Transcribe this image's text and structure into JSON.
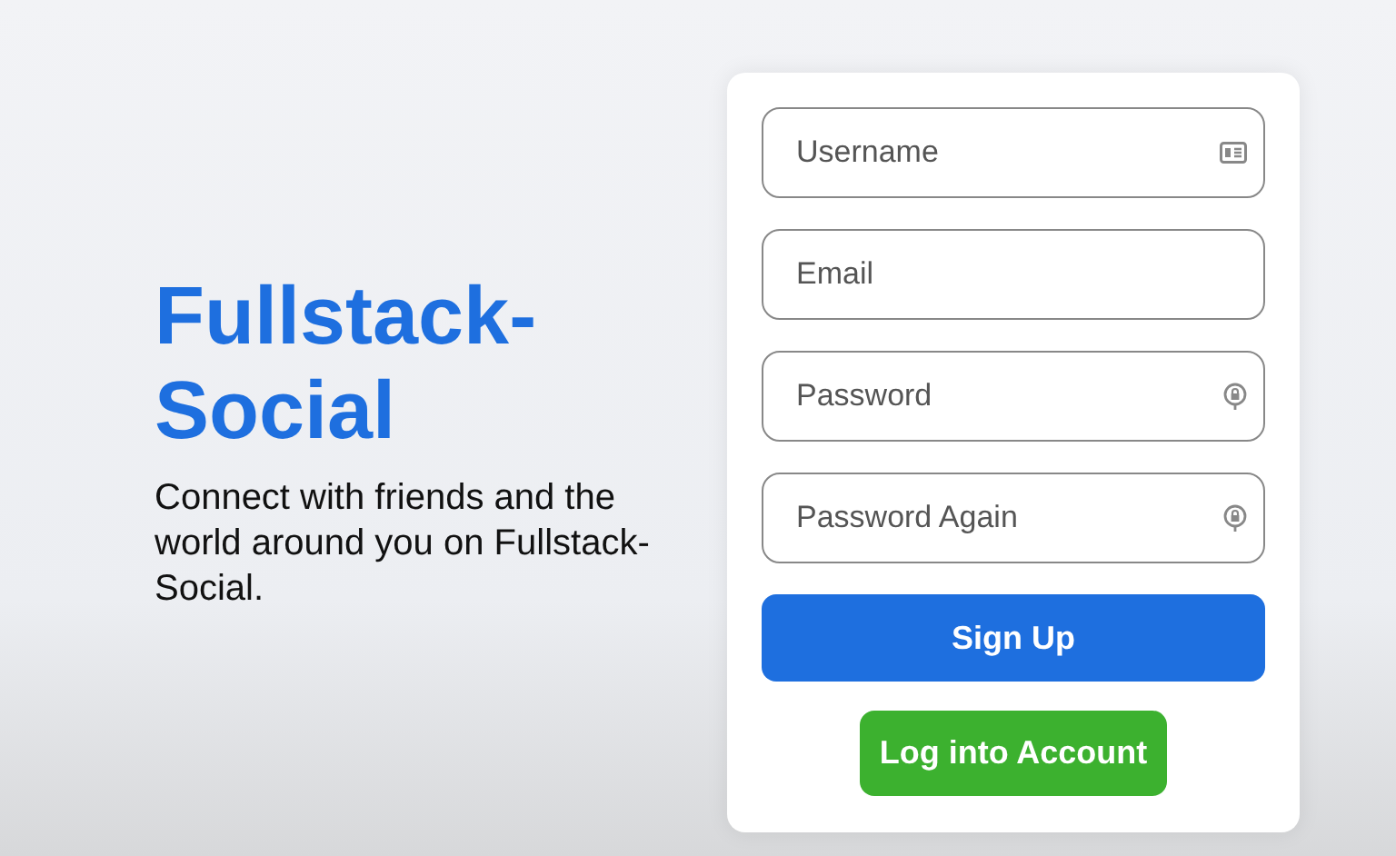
{
  "brand": {
    "title": "Fullstack-Social",
    "tagline": "Connect with friends and the world around you on Fullstack-Social."
  },
  "form": {
    "fields": [
      {
        "placeholder": "Username",
        "kind": "username"
      },
      {
        "placeholder": "Email",
        "kind": "email"
      },
      {
        "placeholder": "Password",
        "kind": "password"
      },
      {
        "placeholder": "Password Again",
        "kind": "password"
      }
    ],
    "primary_button": "Sign Up",
    "secondary_button": "Log into Account"
  }
}
